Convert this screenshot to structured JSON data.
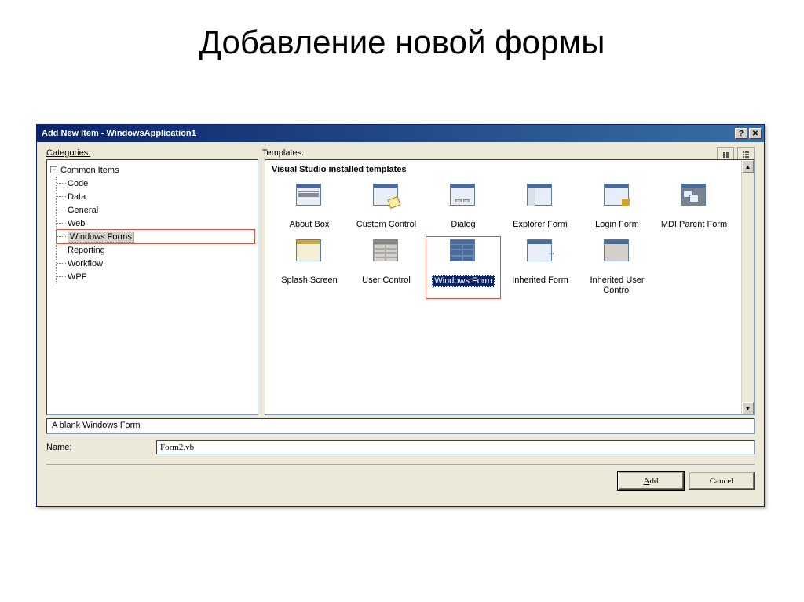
{
  "slide_title": "Добавление новой формы",
  "titlebar": "Add New Item - WindowsApplication1",
  "help_btn": "?",
  "close_btn": "✕",
  "labels": {
    "categories": "ategories:",
    "categories_ul": "C",
    "templates": "Templates:"
  },
  "tree": {
    "root": "Common Items",
    "toggle": "−",
    "items": [
      "Code",
      "Data",
      "General",
      "Web",
      "Windows Forms",
      "Reporting",
      "Workflow",
      "WPF"
    ]
  },
  "template_header": "Visual Studio installed templates",
  "templates": [
    {
      "label": "About Box",
      "icon": "about"
    },
    {
      "label": "Custom Control",
      "icon": "custom"
    },
    {
      "label": "Dialog",
      "icon": "dialog-i"
    },
    {
      "label": "Explorer Form",
      "icon": "explorer"
    },
    {
      "label": "Login Form",
      "icon": "login"
    },
    {
      "label": "MDI Parent Form",
      "icon": "mdi"
    },
    {
      "label": "Splash Screen",
      "icon": "splash"
    },
    {
      "label": "User Control",
      "icon": "usercontrol"
    },
    {
      "label": "Windows Form",
      "icon": "winform",
      "selected": true
    },
    {
      "label": "Inherited Form",
      "icon": "inherited"
    },
    {
      "label": "Inherited User Control",
      "icon": "inhuser"
    }
  ],
  "description": "A blank Windows Form",
  "name_label": "ame:",
  "name_label_ul": "N",
  "name_value": "Form2.vb",
  "buttons": {
    "add": "dd",
    "add_ul": "A",
    "cancel": "Cancel"
  },
  "scroll": {
    "up": "▲",
    "down": "▼"
  }
}
